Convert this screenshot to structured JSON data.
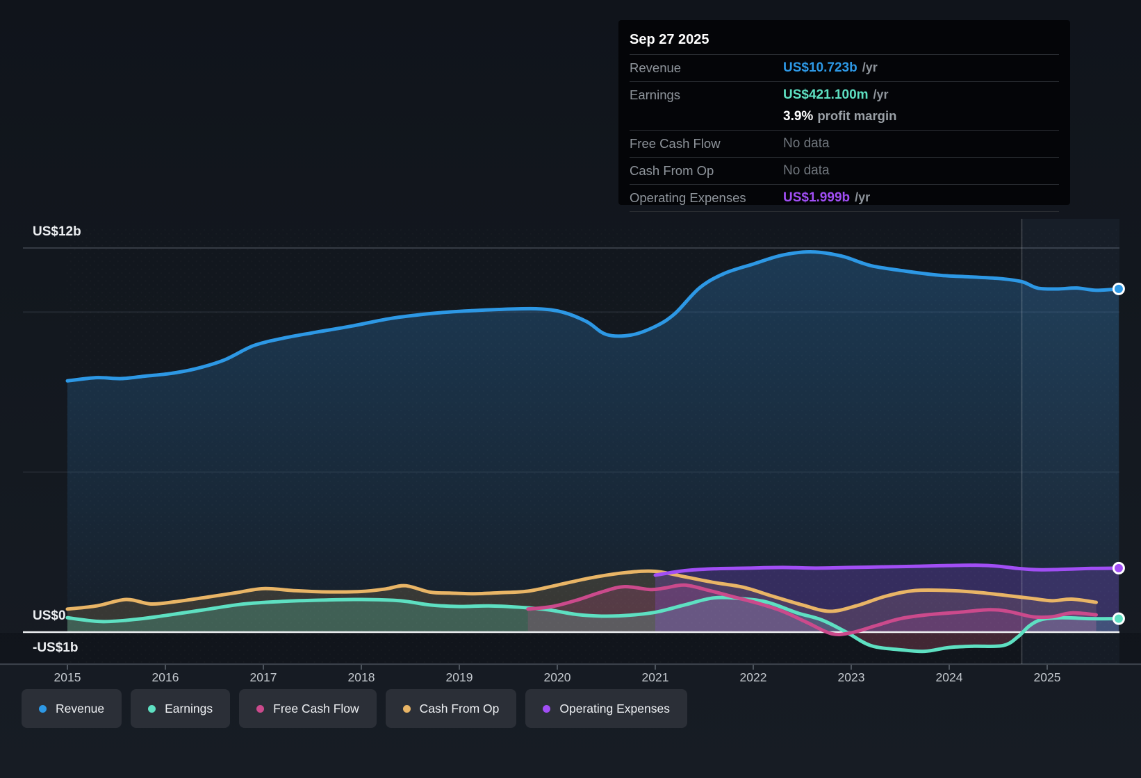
{
  "tooltip": {
    "date": "Sep 27 2025",
    "rows": [
      {
        "label": "Revenue",
        "value": "US$10.723b",
        "suffix": "/yr",
        "color": "#2d98e5"
      },
      {
        "label": "Earnings",
        "value": "US$421.100m",
        "suffix": "/yr",
        "color": "#5ee0c2"
      },
      {
        "label": "Free Cash Flow",
        "value": "No data",
        "suffix": "",
        "color": ""
      },
      {
        "label": "Cash From Op",
        "value": "No data",
        "suffix": "",
        "color": ""
      },
      {
        "label": "Operating Expenses",
        "value": "US$1.999b",
        "suffix": "/yr",
        "color": "#a14ef5"
      }
    ],
    "margin_value": "3.9%",
    "margin_text": "profit margin"
  },
  "legend": {
    "items": [
      {
        "label": "Revenue",
        "color": "#2d98e5"
      },
      {
        "label": "Earnings",
        "color": "#5ee0c2"
      },
      {
        "label": "Free Cash Flow",
        "color": "#cb4a8c"
      },
      {
        "label": "Cash From Op",
        "color": "#e9b566"
      },
      {
        "label": "Operating Expenses",
        "color": "#a14ef5"
      }
    ]
  },
  "chart_data": {
    "type": "area",
    "title": "Revenue and expenses history (US$ billions per year)",
    "unit": "US$ billions /yr",
    "xlim": [
      2015,
      2025.75
    ],
    "ylim": [
      -1,
      12.3
    ],
    "grid": true,
    "legend_position": "bottom",
    "x_ticks": [
      2015,
      2016,
      2017,
      2018,
      2019,
      2020,
      2021,
      2022,
      2023,
      2024,
      2025
    ],
    "y_gridlines": [
      {
        "value": 12,
        "label": "US$12b"
      },
      {
        "value": 10,
        "label": ""
      },
      {
        "value": 5,
        "label": ""
      },
      {
        "value": 0,
        "label": "US$0"
      },
      {
        "value": -1,
        "label": "-US$1b"
      }
    ],
    "divider_x": 2024.74,
    "highlight_range": [
      2024.74,
      2025.75
    ],
    "series": [
      {
        "name": "Revenue",
        "color": "#2d98e5",
        "end_marker": true,
        "fill": "gradient",
        "points": [
          [
            2015.0,
            7.85
          ],
          [
            2015.3,
            7.95
          ],
          [
            2015.55,
            7.92
          ],
          [
            2015.8,
            8.0
          ],
          [
            2016.05,
            8.08
          ],
          [
            2016.3,
            8.22
          ],
          [
            2016.6,
            8.5
          ],
          [
            2016.9,
            8.95
          ],
          [
            2017.2,
            9.18
          ],
          [
            2017.5,
            9.35
          ],
          [
            2017.9,
            9.56
          ],
          [
            2018.3,
            9.8
          ],
          [
            2018.7,
            9.95
          ],
          [
            2019.0,
            10.02
          ],
          [
            2019.4,
            10.08
          ],
          [
            2019.8,
            10.1
          ],
          [
            2020.05,
            10.0
          ],
          [
            2020.3,
            9.7
          ],
          [
            2020.5,
            9.3
          ],
          [
            2020.75,
            9.28
          ],
          [
            2021.0,
            9.55
          ],
          [
            2021.2,
            9.95
          ],
          [
            2021.45,
            10.75
          ],
          [
            2021.7,
            11.2
          ],
          [
            2022.0,
            11.5
          ],
          [
            2022.3,
            11.78
          ],
          [
            2022.6,
            11.88
          ],
          [
            2022.9,
            11.75
          ],
          [
            2023.2,
            11.45
          ],
          [
            2023.55,
            11.28
          ],
          [
            2023.9,
            11.15
          ],
          [
            2024.2,
            11.1
          ],
          [
            2024.5,
            11.05
          ],
          [
            2024.74,
            10.95
          ],
          [
            2024.9,
            10.75
          ],
          [
            2025.1,
            10.72
          ],
          [
            2025.3,
            10.75
          ],
          [
            2025.5,
            10.68
          ],
          [
            2025.73,
            10.723
          ]
        ]
      },
      {
        "name": "Cash From Op",
        "color": "#e9b566",
        "end_marker": false,
        "fill": "flat",
        "points": [
          [
            2015.0,
            0.72
          ],
          [
            2015.3,
            0.82
          ],
          [
            2015.6,
            1.02
          ],
          [
            2015.85,
            0.88
          ],
          [
            2016.1,
            0.95
          ],
          [
            2016.4,
            1.08
          ],
          [
            2016.7,
            1.22
          ],
          [
            2017.0,
            1.36
          ],
          [
            2017.3,
            1.3
          ],
          [
            2017.6,
            1.26
          ],
          [
            2018.0,
            1.27
          ],
          [
            2018.25,
            1.35
          ],
          [
            2018.45,
            1.45
          ],
          [
            2018.7,
            1.25
          ],
          [
            2018.9,
            1.22
          ],
          [
            2019.15,
            1.2
          ],
          [
            2019.4,
            1.23
          ],
          [
            2019.7,
            1.28
          ],
          [
            2020.0,
            1.47
          ],
          [
            2020.35,
            1.7
          ],
          [
            2020.7,
            1.86
          ],
          [
            2021.0,
            1.9
          ],
          [
            2021.3,
            1.73
          ],
          [
            2021.6,
            1.55
          ],
          [
            2021.9,
            1.4
          ],
          [
            2022.2,
            1.12
          ],
          [
            2022.5,
            0.85
          ],
          [
            2022.78,
            0.65
          ],
          [
            2023.05,
            0.82
          ],
          [
            2023.35,
            1.12
          ],
          [
            2023.65,
            1.3
          ],
          [
            2024.0,
            1.3
          ],
          [
            2024.3,
            1.24
          ],
          [
            2024.6,
            1.14
          ],
          [
            2024.85,
            1.05
          ],
          [
            2025.05,
            0.98
          ],
          [
            2025.25,
            1.03
          ],
          [
            2025.5,
            0.93
          ]
        ]
      },
      {
        "name": "Earnings",
        "color": "#5ee0c2",
        "end_marker": true,
        "fill": "flat",
        "points": [
          [
            2015.0,
            0.45
          ],
          [
            2015.35,
            0.33
          ],
          [
            2015.7,
            0.4
          ],
          [
            2016.0,
            0.52
          ],
          [
            2016.4,
            0.7
          ],
          [
            2016.8,
            0.88
          ],
          [
            2017.2,
            0.96
          ],
          [
            2017.6,
            1.0
          ],
          [
            2018.0,
            1.02
          ],
          [
            2018.4,
            0.98
          ],
          [
            2018.7,
            0.85
          ],
          [
            2019.0,
            0.8
          ],
          [
            2019.3,
            0.82
          ],
          [
            2019.6,
            0.78
          ],
          [
            2019.9,
            0.7
          ],
          [
            2020.2,
            0.55
          ],
          [
            2020.45,
            0.5
          ],
          [
            2020.7,
            0.52
          ],
          [
            2021.0,
            0.62
          ],
          [
            2021.3,
            0.85
          ],
          [
            2021.6,
            1.07
          ],
          [
            2021.9,
            1.04
          ],
          [
            2022.15,
            0.93
          ],
          [
            2022.45,
            0.6
          ],
          [
            2022.7,
            0.38
          ],
          [
            2022.95,
            0.0
          ],
          [
            2023.2,
            -0.42
          ],
          [
            2023.5,
            -0.55
          ],
          [
            2023.75,
            -0.6
          ],
          [
            2024.0,
            -0.48
          ],
          [
            2024.25,
            -0.44
          ],
          [
            2024.55,
            -0.42
          ],
          [
            2024.7,
            -0.15
          ],
          [
            2024.82,
            0.2
          ],
          [
            2024.95,
            0.4
          ],
          [
            2025.15,
            0.45
          ],
          [
            2025.45,
            0.42
          ],
          [
            2025.73,
            0.421
          ]
        ]
      },
      {
        "name": "Free Cash Flow",
        "color": "#cb4a8c",
        "end_marker": false,
        "fill": "flat",
        "points": [
          [
            2019.7,
            0.72
          ],
          [
            2019.95,
            0.8
          ],
          [
            2020.2,
            1.0
          ],
          [
            2020.45,
            1.25
          ],
          [
            2020.68,
            1.42
          ],
          [
            2020.95,
            1.33
          ],
          [
            2021.1,
            1.38
          ],
          [
            2021.3,
            1.47
          ],
          [
            2021.55,
            1.3
          ],
          [
            2021.8,
            1.1
          ],
          [
            2022.05,
            0.9
          ],
          [
            2022.3,
            0.65
          ],
          [
            2022.55,
            0.3
          ],
          [
            2022.8,
            -0.05
          ],
          [
            2023.0,
            -0.02
          ],
          [
            2023.25,
            0.2
          ],
          [
            2023.5,
            0.42
          ],
          [
            2023.8,
            0.55
          ],
          [
            2024.1,
            0.62
          ],
          [
            2024.4,
            0.7
          ],
          [
            2024.6,
            0.65
          ],
          [
            2024.85,
            0.48
          ],
          [
            2025.05,
            0.48
          ],
          [
            2025.25,
            0.6
          ],
          [
            2025.5,
            0.54
          ]
        ]
      },
      {
        "name": "Operating Expenses",
        "color": "#a14ef5",
        "end_marker": true,
        "fill": "flat",
        "points": [
          [
            2021.0,
            1.78
          ],
          [
            2021.3,
            1.92
          ],
          [
            2021.6,
            1.98
          ],
          [
            2021.95,
            2.0
          ],
          [
            2022.3,
            2.02
          ],
          [
            2022.65,
            2.0
          ],
          [
            2023.0,
            2.02
          ],
          [
            2023.35,
            2.04
          ],
          [
            2023.7,
            2.06
          ],
          [
            2024.0,
            2.08
          ],
          [
            2024.3,
            2.09
          ],
          [
            2024.5,
            2.06
          ],
          [
            2024.7,
            1.99
          ],
          [
            2024.9,
            1.95
          ],
          [
            2025.15,
            1.96
          ],
          [
            2025.45,
            1.99
          ],
          [
            2025.73,
            1.999
          ]
        ]
      }
    ]
  }
}
